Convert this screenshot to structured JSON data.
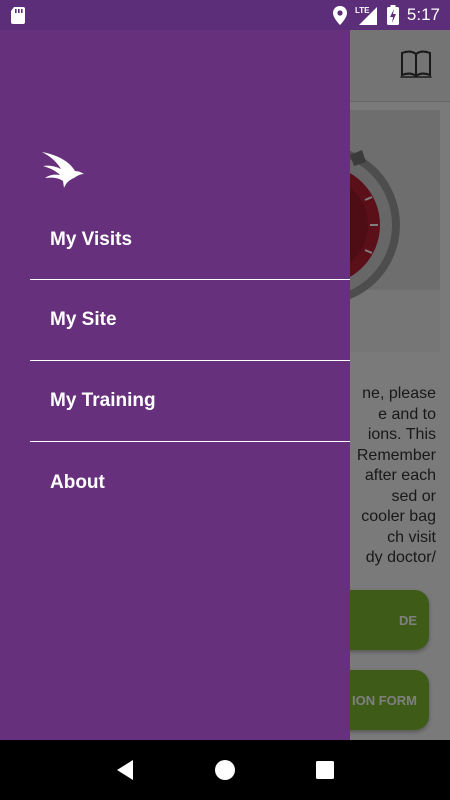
{
  "status_bar": {
    "time": "5:17",
    "network": "LTE",
    "icons": [
      "sd-card-icon",
      "location-icon",
      "signal-icon",
      "battery-charging-icon"
    ]
  },
  "app": {
    "header_icon": "book-icon",
    "body_text_lines": [
      "ne, please",
      "e and to",
      "ions. This",
      "Remember",
      "after each",
      "sed or",
      "cooler bag",
      "ch visit",
      "dy doctor/"
    ],
    "buttons": [
      {
        "label": "DE"
      },
      {
        "label": "ION FORM"
      }
    ],
    "colors": {
      "button_green": "#7cb82f"
    }
  },
  "drawer": {
    "logo": "bird-logo",
    "items": [
      {
        "label": "My Visits"
      },
      {
        "label": "My Site"
      },
      {
        "label": "My Training"
      },
      {
        "label": "About"
      }
    ],
    "colors": {
      "background": "#67307c",
      "divider": "#ffffff"
    }
  },
  "nav_bar": {
    "icons": [
      "back-icon",
      "home-icon",
      "recents-icon"
    ]
  }
}
